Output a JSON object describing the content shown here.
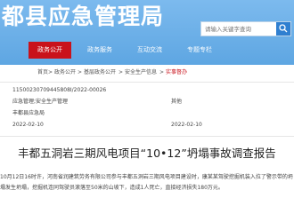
{
  "header": {
    "site_title": "都县应急管理局",
    "search_placeholder": "请输入关键字查询"
  },
  "nav": {
    "items": [
      "政务公开",
      "政务服务",
      "互动交流",
      "专题专栏"
    ],
    "active_index": 0
  },
  "breadcrumb": {
    "items": [
      "首页",
      "政务公开",
      "基层政务公开",
      "安全生产信息"
    ],
    "current": "实事督办"
  },
  "meta": {
    "index_no": "11500230709445808I/2022-00026",
    "category": "应急管理;安全生产管理",
    "category_right": "其他",
    "publisher": "丰都县应急局",
    "created": "2022-02-10",
    "published": "2022-02-10"
  },
  "document": {
    "title": "丰都五洞岩三期风电项目“10•12”坍塌事故调查报告",
    "body_lines": [
      "10月12日16时许，河南省润建筑劳务有限公司参与丰都五洞岩三期风电项目建设时，康某某驾驶挖掘机装入拉了警示带的坍",
      "塌发生坍塌，挖掘机连同驾驶员滚落至50米的山坡下，造成1人死亡，直接经济损失180万元。"
    ]
  },
  "colors": {
    "header_bg": "#6fb1e6",
    "nav_active": "#c9121b",
    "search_button": "#2f7fd0"
  }
}
